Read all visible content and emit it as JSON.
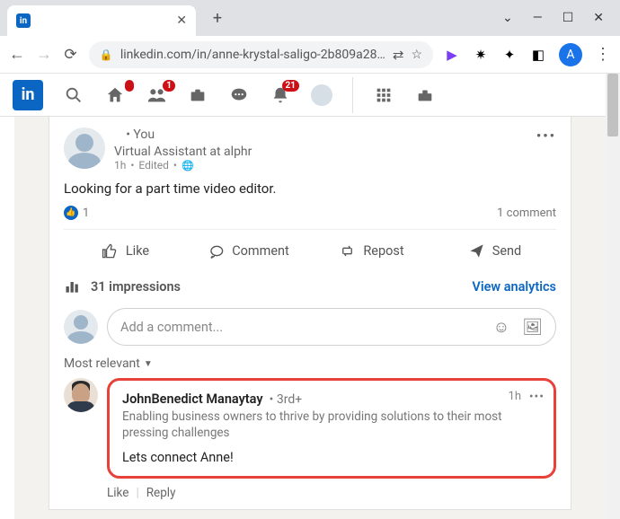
{
  "browser": {
    "tab_title": "",
    "url": "linkedin.com/in/anne-krystal-saligo-2b809a28…",
    "profile_letter": "A"
  },
  "nav": {
    "notif_badge": "21",
    "net_badge": "1"
  },
  "post": {
    "you_label": "• You",
    "headline": "Virtual Assistant at alphr",
    "time": "1h",
    "edited": "Edited",
    "body": "Looking for a part time video editor.",
    "like_count": "1",
    "comment_count": "1 comment",
    "actions": {
      "like": "Like",
      "comment": "Comment",
      "repost": "Repost",
      "send": "Send"
    },
    "impressions": "31 impressions",
    "analytics": "View analytics",
    "comment_placeholder": "Add a comment...",
    "sort_label": "Most relevant"
  },
  "comment": {
    "author": "JohnBenedict Manaytay",
    "degree": "3rd+",
    "time": "1h",
    "headline": "Enabling business owners to thrive by providing solutions to their most pressing challenges",
    "text": "Lets connect Anne!",
    "like": "Like",
    "reply": "Reply"
  }
}
